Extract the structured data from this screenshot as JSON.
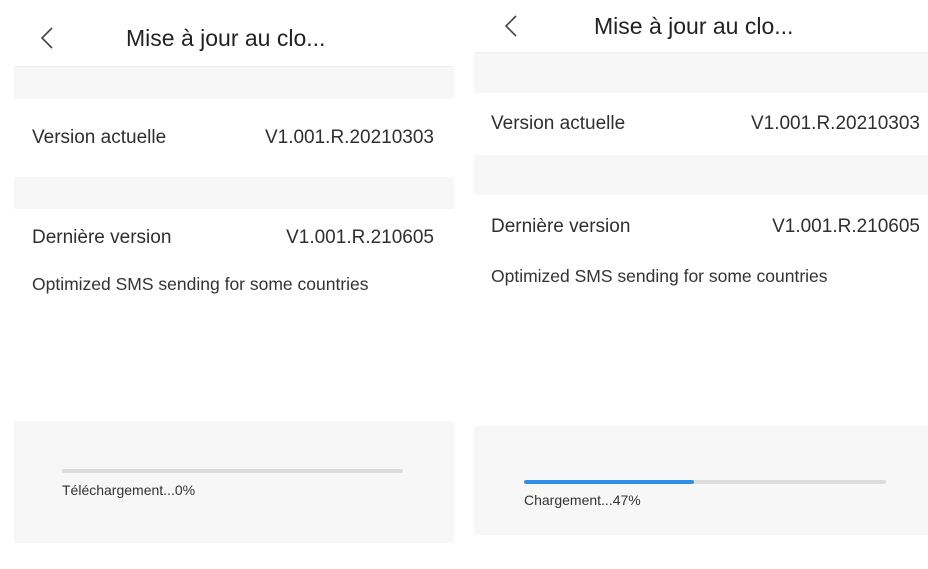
{
  "screens": [
    {
      "title": "Mise à jour au clo...",
      "back_icon": "chevron-left-icon",
      "current_version_label": "Version actuelle",
      "current_version_value": "V1.001.R.20210303",
      "latest_version_label": "Dernière version",
      "latest_version_value": "V1.001.R.210605",
      "release_notes": "Optimized SMS sending for some countries",
      "progress_text": "Téléchargement...0%",
      "progress_fraction": 0.0
    },
    {
      "title": "Mise à jour au clo...",
      "back_icon": "chevron-left-icon",
      "current_version_label": "Version actuelle",
      "current_version_value": "V1.001.R.20210303",
      "latest_version_label": "Dernière version",
      "latest_version_value": "V1.001.R.210605",
      "release_notes": "Optimized SMS sending for some countries",
      "progress_text": "Chargement...47%",
      "progress_fraction": 0.47
    }
  ],
  "colors": {
    "accent": "#2f8fe8",
    "panel": "#f7f7f7",
    "track": "#dcdcdc"
  }
}
